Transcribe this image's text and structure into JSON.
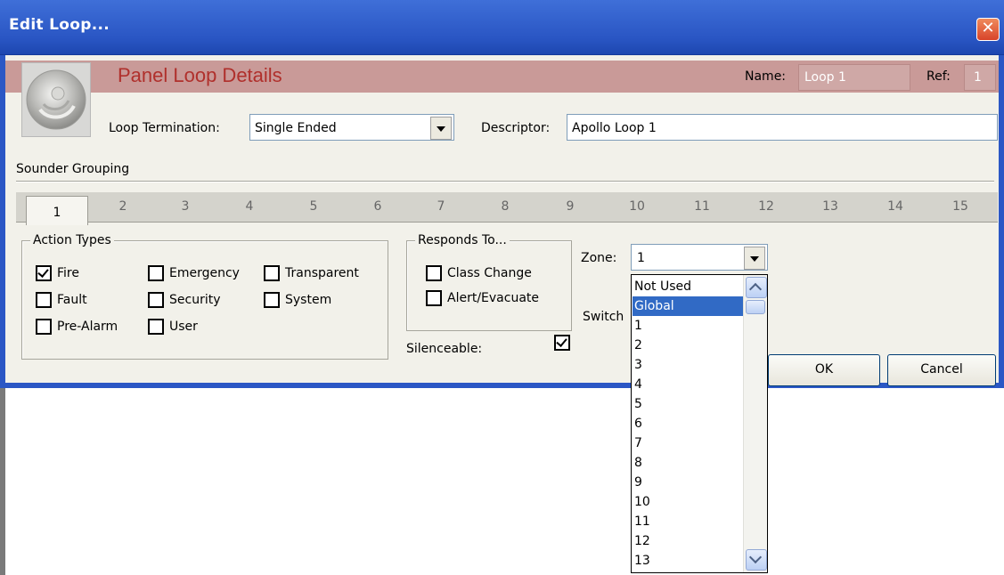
{
  "window": {
    "title": "Edit Loop...",
    "close_symbol": "✕"
  },
  "header": {
    "title": "Panel Loop Details",
    "name_label": "Name:",
    "name_value": "Loop 1",
    "ref_label": "Ref:",
    "ref_value": "1"
  },
  "loop": {
    "termination_label": "Loop Termination:",
    "termination_value": "Single Ended",
    "descriptor_label": "Descriptor:",
    "descriptor_value": "Apollo Loop 1"
  },
  "sounder": {
    "label": "Sounder Grouping"
  },
  "tabs": [
    "1",
    "2",
    "3",
    "4",
    "5",
    "6",
    "7",
    "8",
    "9",
    "10",
    "11",
    "12",
    "13",
    "14",
    "15"
  ],
  "action_types": {
    "title": "Action Types",
    "items": [
      {
        "label": "Fire",
        "checked": true
      },
      {
        "label": "Emergency",
        "checked": false
      },
      {
        "label": "Transparent",
        "checked": false
      },
      {
        "label": "Fault",
        "checked": false
      },
      {
        "label": "Security",
        "checked": false
      },
      {
        "label": "System",
        "checked": false
      },
      {
        "label": "Pre-Alarm",
        "checked": false
      },
      {
        "label": "User",
        "checked": false
      }
    ]
  },
  "responds_to": {
    "title": "Responds To...",
    "items": [
      {
        "label": "Class Change",
        "checked": false
      },
      {
        "label": "Alert/Evacuate",
        "checked": false
      }
    ]
  },
  "silenceable": {
    "label": "Silenceable:",
    "checked": true
  },
  "zone": {
    "label": "Zone:",
    "value": "1",
    "switch_label_partial": "Switch"
  },
  "zone_options": [
    "Not Used",
    "Global",
    "1",
    "2",
    "3",
    "4",
    "5",
    "6",
    "7",
    "8",
    "9",
    "10",
    "11",
    "12",
    "13"
  ],
  "zone_selected": "Global",
  "buttons": {
    "ok": "OK",
    "cancel": "Cancel"
  },
  "colors": {
    "title_bar": "#2a56c4",
    "header_band": "#c99a98",
    "panel_title": "#b0302c",
    "selection": "#316ac5"
  }
}
